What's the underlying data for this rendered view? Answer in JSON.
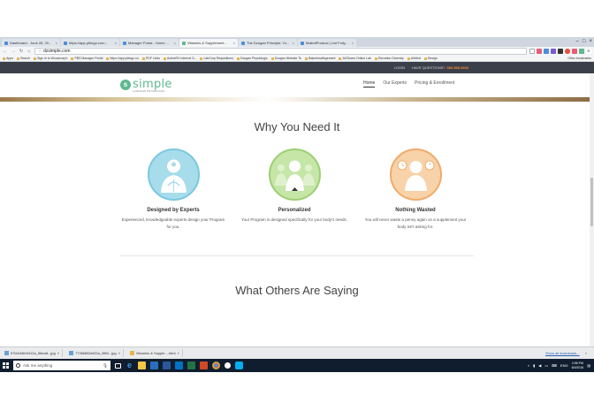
{
  "browser": {
    "tabs": [
      {
        "label": "Dashboard - June 28, 20...",
        "active": false
      },
      {
        "label": "https://app.pbingo.com...",
        "active": false
      },
      {
        "label": "Manager Portal - Home ...",
        "active": false
      },
      {
        "label": "Vitamins & Supplement...",
        "active": true
      },
      {
        "label": "The Dzugan Principle: Yo...",
        "active": false
      },
      {
        "label": "MakeitProduct | List Fully...",
        "active": false
      }
    ],
    "url": "dzsimple.com",
    "bookmarks": [
      "Apps",
      "Search",
      "Sign in to Woosmorph",
      "PBS Manager Portal",
      "https://app.pbingo.co",
      "PDF Links",
      "ActiveRX Internet S...",
      "LabCorp Requisitions",
      "Dzugan Physiologic",
      "Dzugan Website Tk",
      "Bakerhealthgement",
      "All Boxes Online Lab",
      "Elevation Diversity",
      "AirMed",
      "Design"
    ],
    "other_bookmarks": "Other bookmarks"
  },
  "site": {
    "topbar": {
      "login": "LOGIN",
      "question": "HAVE QUESTIONS?",
      "phone": "866.598.3666"
    },
    "logo": {
      "word": "simple",
      "sub": "a DZUGAN PHYSIOLOGIC"
    },
    "nav": [
      {
        "label": "Home",
        "active": true
      },
      {
        "label": "Our Experts",
        "active": false
      },
      {
        "label": "Pricing & Enrollment",
        "active": false
      }
    ],
    "section1_title": "Why You Need It",
    "features": [
      {
        "title": "Designed by Experts",
        "desc": "Experienced, knowledgeable experts design your Program for you.",
        "color": "#a7dceb",
        "border": "#7cc8df",
        "icon": "doctor-icon"
      },
      {
        "title": "Personalized",
        "desc": "Your Program is designed specifically for your body's needs.",
        "color": "#c6e6a8",
        "border": "#9ccf72",
        "icon": "person-icon"
      },
      {
        "title": "Nothing Wasted",
        "desc": "You will never waste a penny again on a supplement your body isn't asking for.",
        "color": "#f8d2a8",
        "border": "#f0ab6a",
        "icon": "user-clock-icon"
      }
    ],
    "section2_title": "What Others Are Saying"
  },
  "downloads": {
    "items": [
      "57b0cf4fe9412a_58ea8...jpg",
      "773fd5f82ef22a_98f4...jpg",
      "Vitamins & Supple....html"
    ],
    "show_all": "Show all downloads...",
    "close": "×"
  },
  "taskbar": {
    "search_placeholder": "Ask me anything",
    "time": "2:58 PM",
    "date": "6/9/2016",
    "lang": "ENG"
  }
}
